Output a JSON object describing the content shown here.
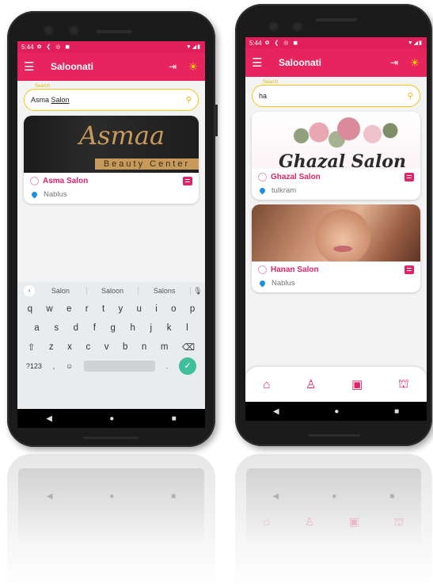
{
  "status_bar": {
    "time": "5:44",
    "icons": "✿ ❮ ◎ ◼",
    "right": "▼◢▮"
  },
  "app": {
    "title": "Saloonati",
    "menu_icon": "☰",
    "logout_icon": "⇥",
    "theme_icon": "☀"
  },
  "left_screen": {
    "search": {
      "label": "Search",
      "value_prefix": "Asma ",
      "value_underlined": "Salon"
    },
    "results": [
      {
        "image_text": "Asmaa",
        "image_band": "Beauty Center",
        "name": "Asma Salon",
        "location": "Nablus"
      }
    ],
    "suggestions": [
      "Salon",
      "Saloon",
      "Salons"
    ],
    "keyboard": {
      "row1": [
        "q",
        "w",
        "e",
        "r",
        "t",
        "y",
        "u",
        "i",
        "o",
        "p"
      ],
      "row2": [
        "a",
        "s",
        "d",
        "f",
        "g",
        "h",
        "j",
        "k",
        "l"
      ],
      "row3": [
        "⇧",
        "z",
        "x",
        "c",
        "v",
        "b",
        "n",
        "m",
        "⌫"
      ],
      "row4": {
        "sym": "?123",
        "comma": ",",
        "emoji": "☺",
        "period": ".",
        "enter": "✓"
      }
    }
  },
  "right_screen": {
    "search": {
      "label": "Search",
      "value": "ha"
    },
    "results": [
      {
        "image_text": "Ghazal Salon",
        "name": "Ghazal Salon",
        "location": "tulkram"
      },
      {
        "name": "Hanan Salon",
        "location": "Nablus"
      }
    ],
    "bottom_tabs": [
      "home-icon",
      "profile-icon",
      "bookings-icon",
      "shop-icon"
    ]
  },
  "nav": {
    "back": "◀",
    "home": "●",
    "recents": "■"
  },
  "colors": {
    "accent": "#e8245f",
    "search_border": "#f5c518",
    "location_pin": "#1e8fe0"
  }
}
